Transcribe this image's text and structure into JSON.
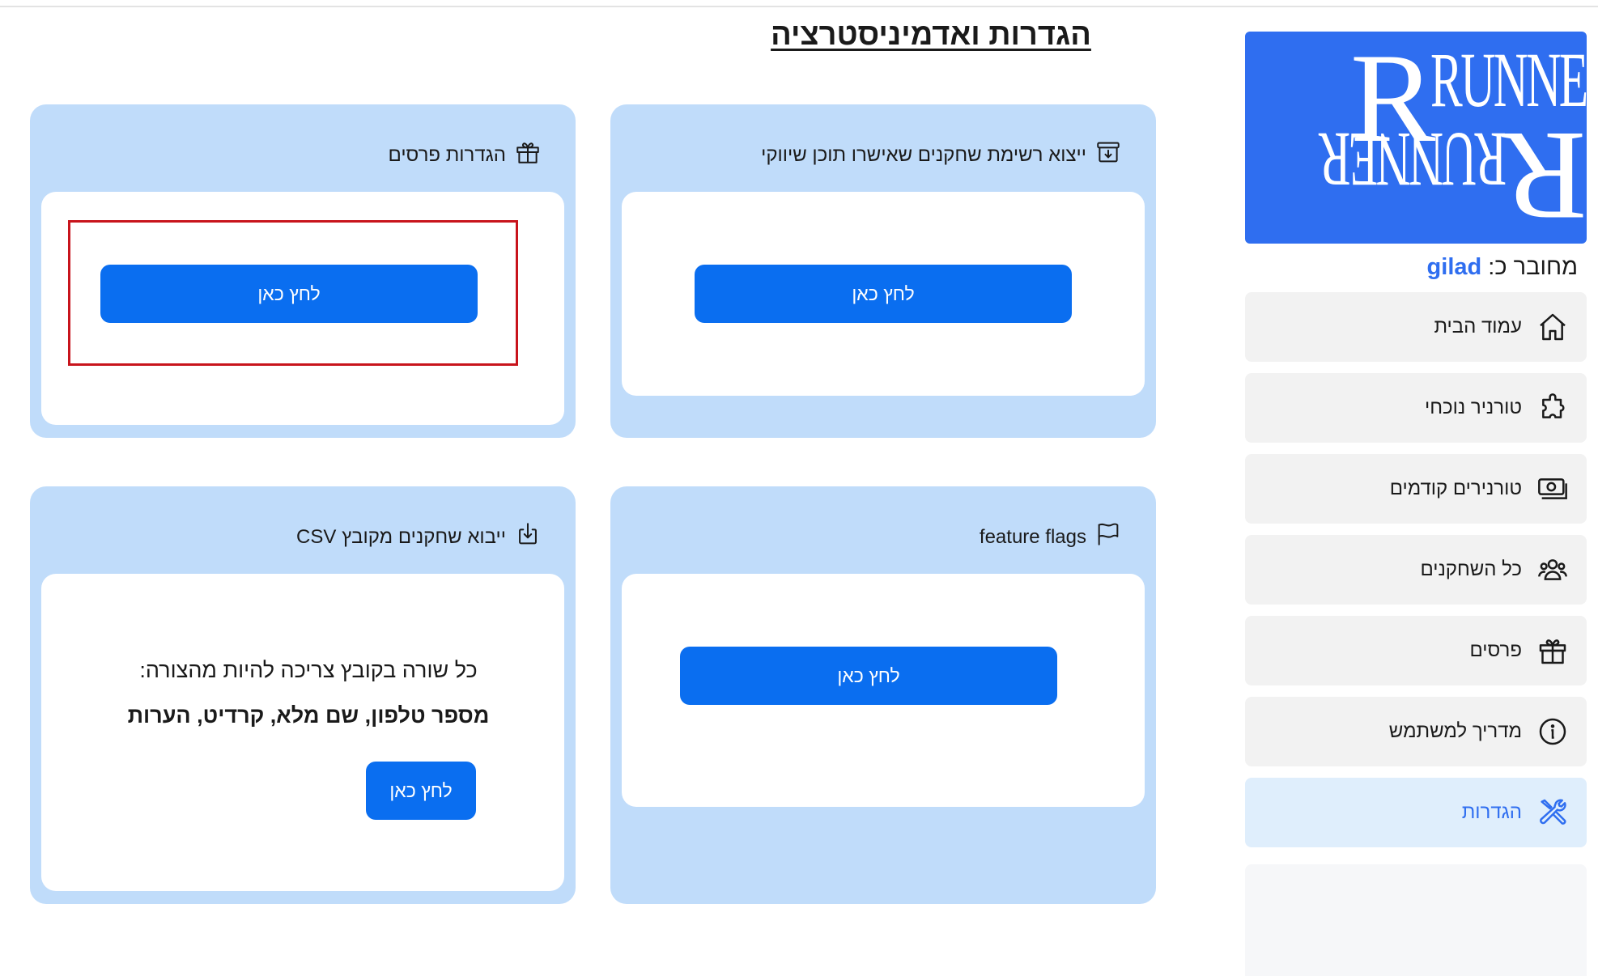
{
  "logo": {
    "top_word": "RUNNER",
    "bottom_word": "RUNNER"
  },
  "sidebar": {
    "connected_label": "מחובר כ:",
    "username": "gilad",
    "items": [
      {
        "label": "עמוד הבית",
        "icon": "home-icon"
      },
      {
        "label": "טורניר נוכחי",
        "icon": "puzzle-icon"
      },
      {
        "label": "טורנירים קודמים",
        "icon": "money-icon"
      },
      {
        "label": "כל השחקנים",
        "icon": "users-icon"
      },
      {
        "label": "פרסים",
        "icon": "gift-icon"
      },
      {
        "label": "מדריך למשתמש",
        "icon": "info-icon"
      },
      {
        "label": "הגדרות",
        "icon": "tools-icon",
        "active": true
      }
    ]
  },
  "page": {
    "title": "הגדרות ואדמיניסטרציה"
  },
  "cards": {
    "export": {
      "title": "ייצוא רשימת שחקנים שאישרו תוכן שיווקי",
      "icon": "archive-download-icon",
      "button": "לחץ כאן"
    },
    "prizes": {
      "title": "הגדרות פרסים",
      "icon": "gift-icon",
      "button": "לחץ כאן"
    },
    "flags": {
      "title": "feature flags",
      "icon": "flag-icon",
      "button": "לחץ כאן"
    },
    "import": {
      "title": "ייבוא שחקנים מקובץ CSV",
      "icon": "file-import-icon",
      "line1": "כל שורה בקובץ צריכה להיות מהצורה:",
      "line2": "מספר טלפון, שם מלא, קרדיט, הערות",
      "button": "לחץ כאן"
    }
  },
  "colors": {
    "accent": "#0a6ef0",
    "card_bg": "#c0dcfa",
    "logo_bg": "#2f6ef0",
    "highlight": "#c8141c",
    "active_nav": "#dfeefc"
  }
}
